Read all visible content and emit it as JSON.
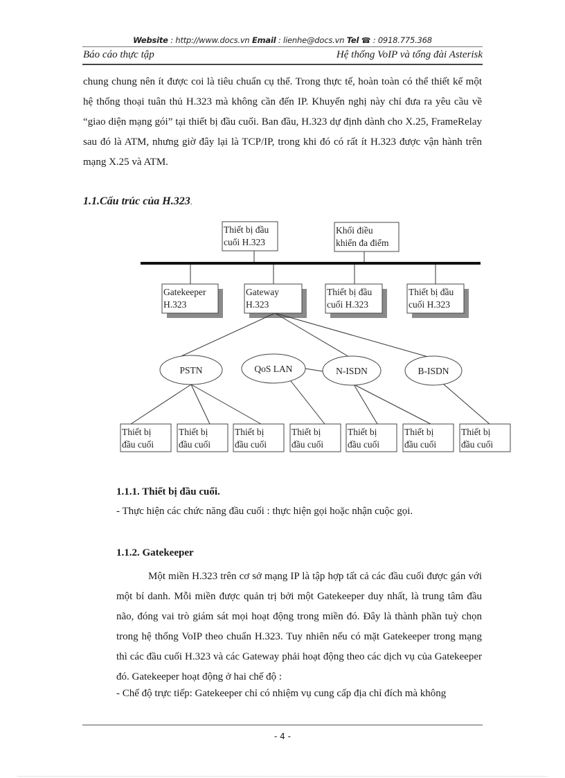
{
  "header": {
    "website_label": "Website",
    "website_value": " : http://www.docs.vn ",
    "email_label": "Email",
    "email_value": "  : lienhe@docs.vn  ",
    "tel_label": "Tel",
    "tel_icon": "☎",
    "tel_value": " : 0918.775.368",
    "left_title": "Báo cáo thực tập",
    "right_title": "Hệ thống VoIP và tổng đài Asterisk"
  },
  "intro_paragraph": "chung chung nên ít được coi là tiêu chuẩn cụ thể. Trong thực tế, hoàn toàn có thể thiết kế một hệ thống thoại tuân thủ H.323 mà không cần đến IP. Khuyến nghị này chỉ đưa ra yêu cầu về “giao diện mạng gói” tại thiết bị đầu cuối. Ban đầu, H.323 dự định dành cho X.25, FrameRelay  sau đó là ATM, nhưng giờ đây lại là TCP/IP, trong khi đó có rất ít H.323 được vận hành trên mạng X.25 và ATM.",
  "section_heading": "1.1.Cấu trúc của H.323",
  "section_heading_suffix": ".",
  "diagram": {
    "top_nodes": [
      {
        "id": "terminal-top",
        "lines": [
          "Thiết bị đầu",
          "cuối H.323"
        ]
      },
      {
        "id": "mcu",
        "lines": [
          "Khối điều",
          "khiển đa điểm"
        ]
      }
    ],
    "mid_nodes": [
      {
        "id": "gatekeeper",
        "lines": [
          "Gatekeeper",
          "H.323"
        ]
      },
      {
        "id": "gateway",
        "lines": [
          "Gateway",
          "H.323"
        ]
      },
      {
        "id": "terminal-mid-1",
        "lines": [
          "Thiết bị đầu",
          "cuối H.323"
        ]
      },
      {
        "id": "terminal-mid-2",
        "lines": [
          "Thiết bị đầu",
          "cuối H.323"
        ]
      }
    ],
    "networks": [
      {
        "id": "pstn",
        "label": "PSTN"
      },
      {
        "id": "qos-lan",
        "label": "QoS LAN"
      },
      {
        "id": "n-isdn",
        "label": "N-ISDN"
      },
      {
        "id": "b-isdn",
        "label": "B-ISDN"
      }
    ],
    "terminals": [
      {
        "lines": [
          "Thiết bị",
          "đầu cuối"
        ],
        "network": "pstn"
      },
      {
        "lines": [
          "Thiết bị",
          "đầu cuối"
        ],
        "network": "pstn"
      },
      {
        "lines": [
          "Thiết bị",
          "đầu cuối"
        ],
        "network": "pstn"
      },
      {
        "lines": [
          "Thiết bị",
          "đầu cuối"
        ],
        "network": "qos-lan"
      },
      {
        "lines": [
          "Thiết bị",
          "đầu cuối"
        ],
        "network": "n-isdn"
      },
      {
        "lines": [
          "Thiết bị",
          "đầu cuối"
        ],
        "network": "n-isdn"
      },
      {
        "lines": [
          "Thiết bị",
          "đầu cuối"
        ],
        "network": "b-isdn"
      }
    ],
    "links": [
      [
        "gateway",
        "pstn"
      ],
      [
        "gateway",
        "n-isdn"
      ],
      [
        "gateway",
        "b-isdn"
      ],
      [
        "qos-lan",
        "n-isdn"
      ]
    ]
  },
  "subsections": [
    {
      "heading": "1.1.1. Thiết bị đầu cuối.",
      "text": "- Thực hiện các chức năng đầu cuối : thực hiện gọi hoặc nhận cuộc gọi."
    },
    {
      "heading": "1.1.2. Gatekeeper",
      "paragraph": "Một miền  H.323 trên cơ sở mạng IP là tập hợp tất cả các đầu cuối được gán với một bí danh. Mỗi miền được quản trị bởi một Gatekeeper duy nhất, là trung tâm đầu não, đóng vai trò giám  sát mọi hoạt động trong miền đó. Đây là thành phần tuỳ chọn trong hệ thống VoIP theo chuẩn H.323. Tuy nhiên nếu có mặt Gatekeeper trong mạng thì các đầu cuối H.323 và các Gateway phải hoạt động theo các dịch vụ của Gatekeeper đó. Gatekeeper hoạt động ở hai chế độ :",
      "last_line": "- Chế độ trực tiếp: Gatekeeper chỉ có nhiệm  vụ cung cấp địa chỉ đích mà không"
    }
  ],
  "footer": {
    "page_number": "- 4 -"
  }
}
